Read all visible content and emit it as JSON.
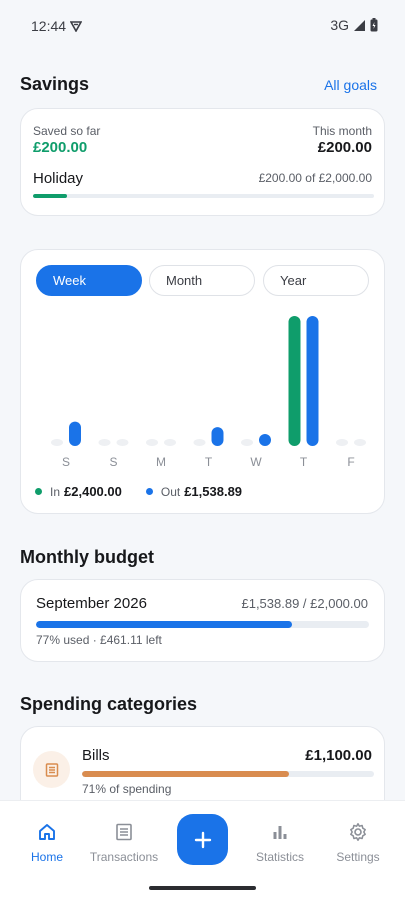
{
  "status": {
    "time": "12:44",
    "network": "3G"
  },
  "savings": {
    "title": "Savings",
    "link": "All goals",
    "saved_label": "Saved so far",
    "saved_value": "£200.00",
    "month_label": "This month",
    "month_value": "£200.00",
    "goal_name": "Holiday",
    "goal_amount": "£200.00 of £2,000.00",
    "goal_progress": 0.1
  },
  "chart": {
    "tabs": [
      "Week",
      "Month",
      "Year"
    ],
    "active_tab": "Week",
    "legend": {
      "in_label": "In",
      "in_value": "£2,400.00",
      "out_label": "Out",
      "out_value": "£1,538.89"
    }
  },
  "chart_data": {
    "type": "bar",
    "categories": [
      "S",
      "S",
      "M",
      "T",
      "W",
      "T",
      "F"
    ],
    "series": [
      {
        "name": "In",
        "values": [
          0,
          0,
          0,
          0,
          0,
          2400,
          0
        ]
      },
      {
        "name": "Out",
        "values": [
          206,
          0,
          0,
          160,
          70,
          1100,
          0
        ]
      }
    ],
    "ylim": [
      0,
      1100
    ]
  },
  "budget": {
    "title": "Monthly budget",
    "month": "September 2026",
    "amount": "£1,538.89 / £2,000.00",
    "progress": 0.77,
    "note": "77% used · £461.11 left"
  },
  "categories": {
    "title": "Spending categories",
    "items": [
      {
        "name": "Bills",
        "amount": "£1,100.00",
        "progress": 0.71,
        "note": "71% of spending",
        "icon": "receipt-icon"
      }
    ]
  },
  "nav": {
    "items": [
      {
        "label": "Home",
        "icon": "home-icon"
      },
      {
        "label": "Transactions",
        "icon": "receipt-icon"
      },
      {
        "label": "Statistics",
        "icon": "bar-chart-icon"
      },
      {
        "label": "Settings",
        "icon": "gear-icon"
      }
    ]
  },
  "colors": {
    "accent": "#1a73e8",
    "income": "#0f9d6b",
    "bills": "#d98c4f"
  }
}
